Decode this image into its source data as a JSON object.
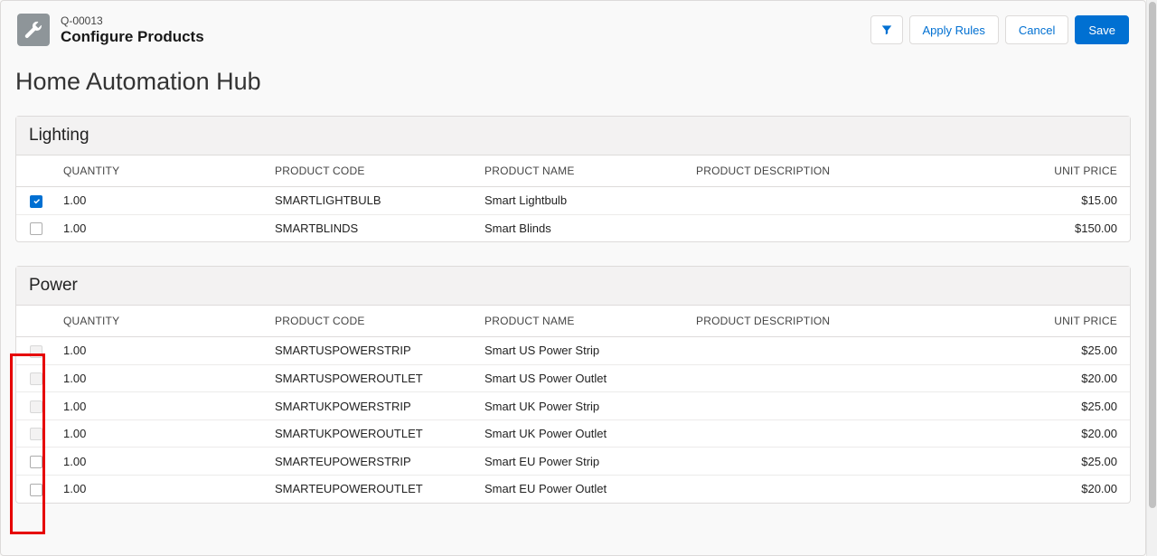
{
  "header": {
    "quote_id": "Q-00013",
    "title": "Configure Products"
  },
  "actions": {
    "apply_rules": "Apply Rules",
    "cancel": "Cancel",
    "save": "Save"
  },
  "product_title": "Home Automation Hub",
  "columns": {
    "quantity": "QUANTITY",
    "product_code": "PRODUCT CODE",
    "product_name": "PRODUCT NAME",
    "product_description": "PRODUCT DESCRIPTION",
    "unit_price": "UNIT PRICE"
  },
  "groups": [
    {
      "name": "Lighting",
      "rows": [
        {
          "checked": true,
          "disabled": false,
          "quantity": "1.00",
          "code": "SMARTLIGHTBULB",
          "name_": "Smart Lightbulb",
          "desc": "",
          "price": "$15.00"
        },
        {
          "checked": false,
          "disabled": false,
          "quantity": "1.00",
          "code": "SMARTBLINDS",
          "name_": "Smart Blinds",
          "desc": "",
          "price": "$150.00"
        }
      ]
    },
    {
      "name": "Power",
      "rows": [
        {
          "checked": false,
          "disabled": true,
          "quantity": "1.00",
          "code": "SMARTUSPOWERSTRIP",
          "name_": "Smart US Power Strip",
          "desc": "",
          "price": "$25.00"
        },
        {
          "checked": false,
          "disabled": true,
          "quantity": "1.00",
          "code": "SMARTUSPOWEROUTLET",
          "name_": "Smart US Power Outlet",
          "desc": "",
          "price": "$20.00"
        },
        {
          "checked": false,
          "disabled": true,
          "quantity": "1.00",
          "code": "SMARTUKPOWERSTRIP",
          "name_": "Smart UK Power Strip",
          "desc": "",
          "price": "$25.00"
        },
        {
          "checked": false,
          "disabled": true,
          "quantity": "1.00",
          "code": "SMARTUKPOWEROUTLET",
          "name_": "Smart UK Power Outlet",
          "desc": "",
          "price": "$20.00"
        },
        {
          "checked": false,
          "disabled": false,
          "quantity": "1.00",
          "code": "SMARTEUPOWERSTRIP",
          "name_": "Smart EU Power Strip",
          "desc": "",
          "price": "$25.00"
        },
        {
          "checked": false,
          "disabled": false,
          "quantity": "1.00",
          "code": "SMARTEUPOWEROUTLET",
          "name_": "Smart EU Power Outlet",
          "desc": "",
          "price": "$20.00"
        }
      ]
    }
  ]
}
